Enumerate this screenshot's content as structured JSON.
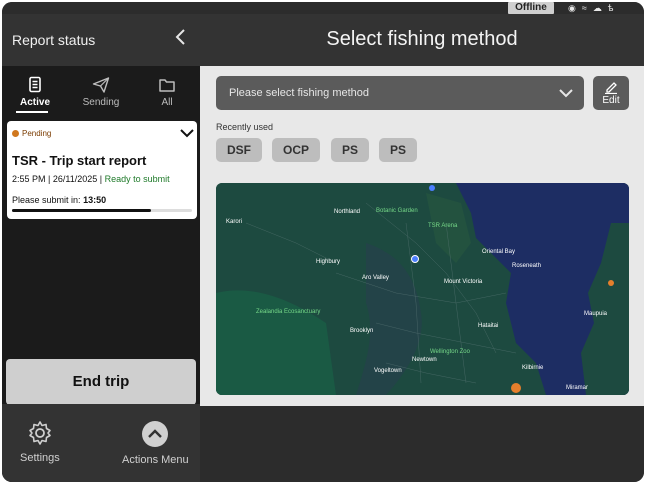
{
  "status_bar": {
    "offline_label": "Offline"
  },
  "sidebar": {
    "title": "Report status",
    "tabs": [
      {
        "label": "Active",
        "icon": "document-icon",
        "active": true
      },
      {
        "label": "Sending",
        "icon": "paper-plane-icon",
        "active": false
      },
      {
        "label": "All",
        "icon": "folder-icon",
        "active": false
      }
    ],
    "report_card": {
      "status": "Pending",
      "status_color": "#d0781e",
      "title": "TSR - Trip start report",
      "time": "2:55 PM",
      "date": "26/11/2025",
      "ready": "Ready to submit",
      "ready_color": "#1f7a2a",
      "submit_prefix": "Please submit in:",
      "submit_countdown": "13:50",
      "progress_fraction": 0.77
    },
    "end_trip_label": "End trip",
    "bottom": {
      "settings_label": "Settings",
      "actions_label": "Actions Menu"
    }
  },
  "main": {
    "title": "Select fishing method",
    "select_placeholder": "Please select fishing method",
    "edit_label": "Edit",
    "recent_label": "Recently used",
    "recent_chips": [
      "DSF",
      "OCP",
      "PS",
      "PS"
    ],
    "map": {
      "water_color": "#1d2d63",
      "land_color": "#1d4a40",
      "labels": [
        {
          "text": "Karori",
          "green": false
        },
        {
          "text": "Northland",
          "green": false
        },
        {
          "text": "Botanic Garden",
          "green": true
        },
        {
          "text": "TSR Arena",
          "green": true
        },
        {
          "text": "Oriental Bay",
          "green": false
        },
        {
          "text": "Highbury",
          "green": false
        },
        {
          "text": "Aro Valley",
          "green": false
        },
        {
          "text": "Mount Victoria",
          "green": false
        },
        {
          "text": "Roseneath",
          "green": false
        },
        {
          "text": "Brooklyn",
          "green": false
        },
        {
          "text": "Hataitai",
          "green": false
        },
        {
          "text": "Vogeltown",
          "green": false
        },
        {
          "text": "Newtown",
          "green": false
        },
        {
          "text": "Kilbirnie",
          "green": false
        },
        {
          "text": "Maupuia",
          "green": false
        },
        {
          "text": "Miramar",
          "green": false
        },
        {
          "text": "Zealandia Ecosanctuary",
          "green": true
        },
        {
          "text": "Wellington Zoo",
          "green": true
        }
      ]
    }
  }
}
